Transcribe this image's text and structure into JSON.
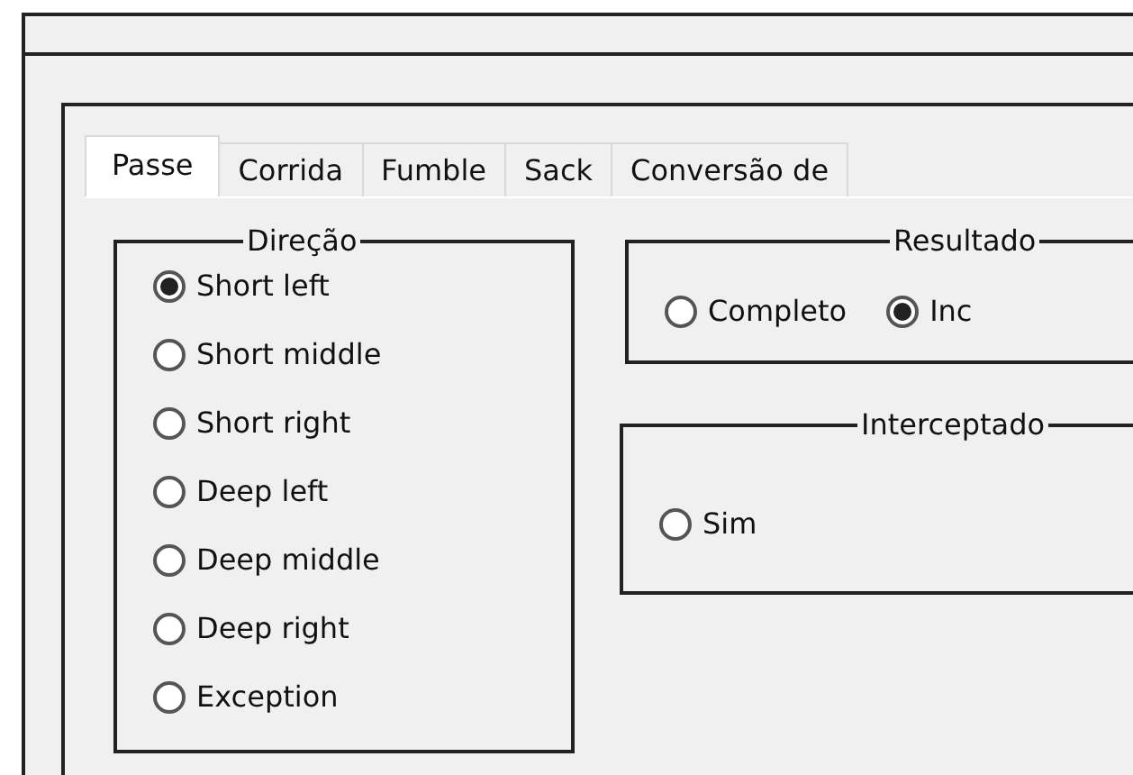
{
  "tabs": [
    {
      "label": "Passe",
      "selected": true
    },
    {
      "label": "Corrida",
      "selected": false
    },
    {
      "label": "Fumble",
      "selected": false
    },
    {
      "label": "Sack",
      "selected": false
    },
    {
      "label": "Conversão de",
      "selected": false
    }
  ],
  "direcao": {
    "title": "Direção",
    "options": [
      {
        "label": "Short left",
        "selected": true
      },
      {
        "label": "Short middle",
        "selected": false
      },
      {
        "label": "Short right",
        "selected": false
      },
      {
        "label": "Deep left",
        "selected": false
      },
      {
        "label": "Deep middle",
        "selected": false
      },
      {
        "label": "Deep right",
        "selected": false
      },
      {
        "label": "Exception",
        "selected": false
      }
    ]
  },
  "resultado": {
    "title": "Resultado",
    "options": [
      {
        "label": "Completo",
        "selected": false
      },
      {
        "label": "Inc",
        "selected": true
      }
    ]
  },
  "interceptado": {
    "title": "Interceptado",
    "options": [
      {
        "label": "Sim",
        "selected": false
      }
    ]
  }
}
